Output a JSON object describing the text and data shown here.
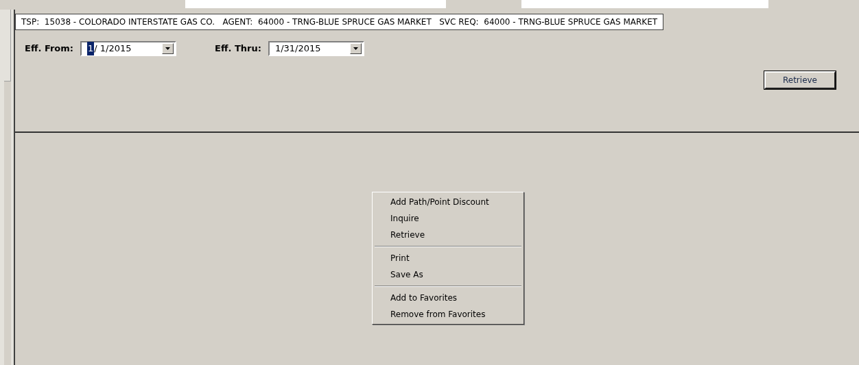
{
  "header": {
    "text": "TSP:  15038 - COLORADO INTERSTATE GAS CO.   AGENT:  64000 - TRNG-BLUE SPRUCE GAS MARKET   SVC REQ:  64000 - TRNG-BLUE SPRUCE GAS MARKET"
  },
  "filters": [
    {
      "label": "Eff. From:",
      "parts": [
        {
          "text": "1",
          "selected": true
        },
        {
          "text": "/ 1/2015",
          "selected": false
        }
      ]
    },
    {
      "label": "Eff. Thru:",
      "parts": [
        {
          "text": "1/31/2015",
          "selected": false
        }
      ]
    }
  ],
  "retrieve_button": "Retrieve",
  "context_menu": {
    "groups": [
      [
        "Add Path/Point Discount",
        "Inquire",
        "Retrieve"
      ],
      [
        "Print",
        "Save As"
      ],
      [
        "Add to Favorites",
        "Remove from Favorites"
      ]
    ]
  }
}
